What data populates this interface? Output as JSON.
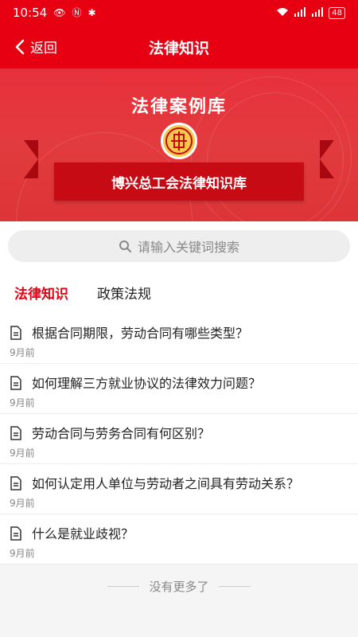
{
  "status": {
    "time": "10:54",
    "battery": "48"
  },
  "nav": {
    "back_label": "返回",
    "title": "法律知识"
  },
  "banner": {
    "title": "法律案例库",
    "ribbon": "博兴总工会法律知识库"
  },
  "search": {
    "placeholder": "请输入关键词搜索"
  },
  "tabs": [
    {
      "label": "法律知识",
      "active": true
    },
    {
      "label": "政策法规",
      "active": false
    }
  ],
  "items": [
    {
      "title": "根据合同期限，劳动合同有哪些类型？",
      "time": "9月前"
    },
    {
      "title": "如何理解三方就业协议的法律效力问题？",
      "time": "9月前"
    },
    {
      "title": "劳动合同与劳务合同有何区别？",
      "time": "9月前"
    },
    {
      "title": "如何认定用人单位与劳动者之间具有劳动关系？",
      "time": "9月前"
    },
    {
      "title": "什么是就业歧视？",
      "time": "9月前"
    }
  ],
  "footer": {
    "no_more": "没有更多了"
  },
  "colors": {
    "primary": "#e60012"
  }
}
